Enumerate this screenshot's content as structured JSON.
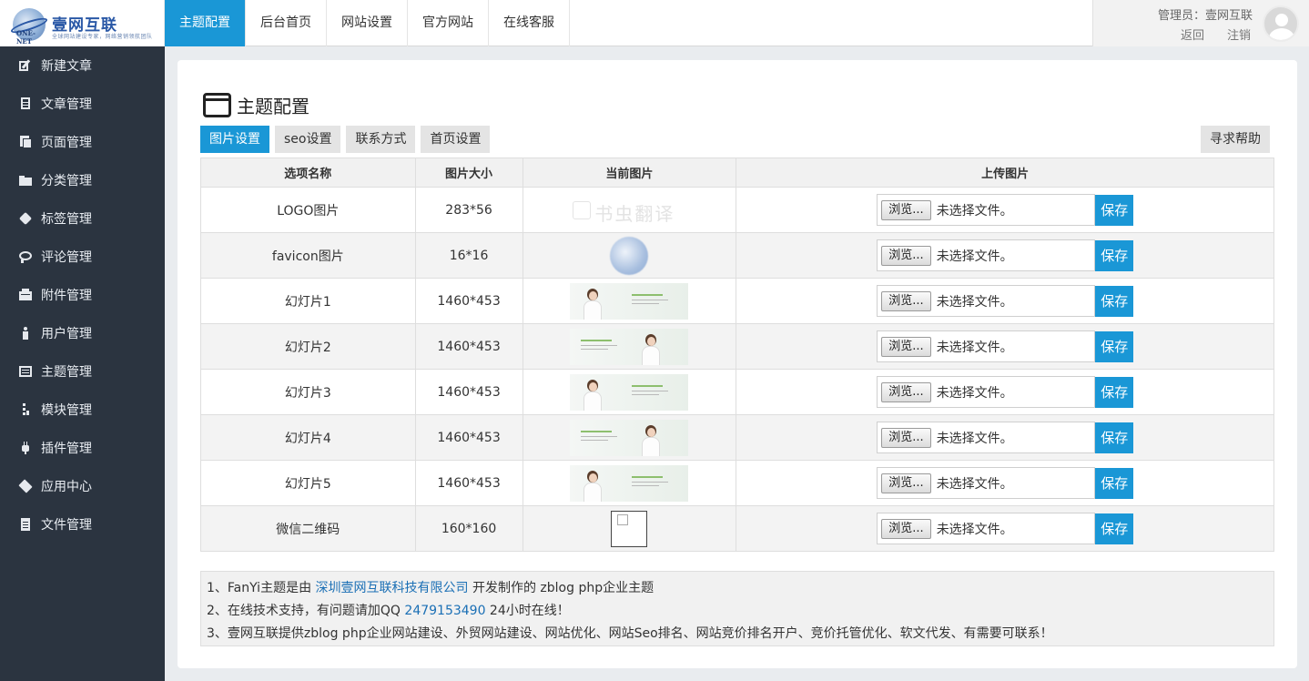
{
  "logo": {
    "title": "壹网互联",
    "subtitle": "全球网站建设专家，网络营销领航团队",
    "mark": "ONE-NET"
  },
  "topnav": [
    {
      "label": "主题配置",
      "active": true
    },
    {
      "label": "后台首页"
    },
    {
      "label": "网站设置"
    },
    {
      "label": "官方网站"
    },
    {
      "label": "在线客服"
    }
  ],
  "user": {
    "admin_label": "管理员：壹网互联",
    "back": "返回",
    "logout": "注销"
  },
  "sidebar": [
    {
      "label": "新建文章",
      "icon": "edit-icon"
    },
    {
      "label": "文章管理",
      "icon": "document-icon"
    },
    {
      "label": "页面管理",
      "icon": "pages-icon"
    },
    {
      "label": "分类管理",
      "icon": "folder-icon"
    },
    {
      "label": "标签管理",
      "icon": "tag-icon"
    },
    {
      "label": "评论管理",
      "icon": "comment-icon"
    },
    {
      "label": "附件管理",
      "icon": "attachment-icon"
    },
    {
      "label": "用户管理",
      "icon": "user-icon"
    },
    {
      "label": "主题管理",
      "icon": "theme-icon"
    },
    {
      "label": "模块管理",
      "icon": "module-icon"
    },
    {
      "label": "插件管理",
      "icon": "plugin-icon"
    },
    {
      "label": "应用中心",
      "icon": "app-icon"
    },
    {
      "label": "文件管理",
      "icon": "file-icon"
    }
  ],
  "page": {
    "title": "主题配置"
  },
  "subtabs": [
    {
      "label": "图片设置",
      "active": true
    },
    {
      "label": "seo设置"
    },
    {
      "label": "联系方式"
    },
    {
      "label": "首页设置"
    }
  ],
  "help_button": "寻求帮助",
  "table": {
    "headers": [
      "选项名称",
      "图片大小",
      "当前图片",
      "上传图片"
    ],
    "rows": [
      {
        "name": "LOGO图片",
        "size": "283*56",
        "thumb": "logo"
      },
      {
        "name": "favicon图片",
        "size": "16*16",
        "thumb": "favicon"
      },
      {
        "name": "幻灯片1",
        "size": "1460*453",
        "thumb": "slide"
      },
      {
        "name": "幻灯片2",
        "size": "1460*453",
        "thumb": "slide"
      },
      {
        "name": "幻灯片3",
        "size": "1460*453",
        "thumb": "slide"
      },
      {
        "name": "幻灯片4",
        "size": "1460*453",
        "thumb": "slide"
      },
      {
        "name": "幻灯片5",
        "size": "1460*453",
        "thumb": "slide"
      },
      {
        "name": "微信二维码",
        "size": "160*160",
        "thumb": "qr"
      }
    ],
    "browse_label": "浏览...",
    "file_status": "未选择文件。",
    "save_label": "保存",
    "logo_watermark": "书虫翻译"
  },
  "notes": {
    "line1_prefix": "1、FanYi主题是由 ",
    "line1_link": "深圳壹网互联科技有限公司",
    "line1_suffix": " 开发制作的 zblog php企业主题",
    "line2_prefix": "2、在线技术支持，有问题请加QQ ",
    "line2_link": "2479153490",
    "line2_suffix": " 24小时在线！",
    "line3": "3、壹网互联提供zblog php企业网站建设、外贸网站建设、网站优化、网站Seo排名、网站竞价排名开户、竞价托管优化、软文代发、有需要可联系！"
  },
  "colors": {
    "accent": "#1a97d6",
    "sidebar": "#2b3440",
    "link": "#1a6fb5"
  }
}
